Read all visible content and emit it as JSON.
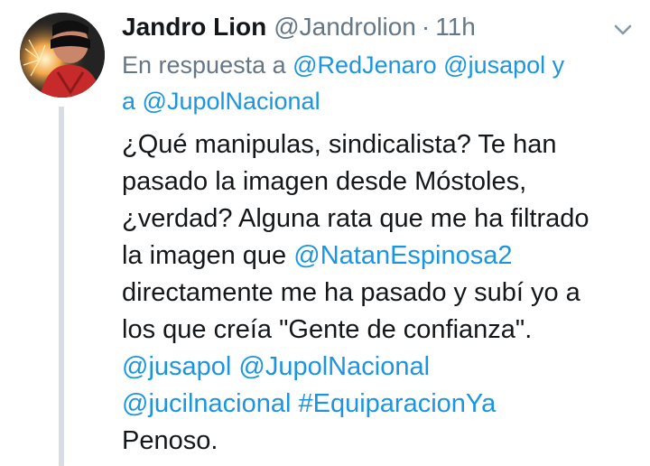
{
  "tweet": {
    "display_name": "Jandro Lion",
    "handle": "@Jandrolion",
    "separator": "·",
    "time": "11h",
    "reply_context": {
      "prefix": "En respuesta a",
      "mention_1": "@RedJenaro",
      "mention_2": "@jusapol",
      "conjunction": "y",
      "a_word": "a",
      "mention_3": "@JupolNacional"
    },
    "body": {
      "line_1": "¿Qué manipulas, sindicalista? Te han",
      "line_2": "pasado la imagen desde Móstoles,",
      "line_3": "¿verdad? Alguna rata que me ha filtrado",
      "line_4_prefix": "la imagen que",
      "mention_natan": "@NatanEspinosa2",
      "line_5": "directamente me ha pasado y subí yo a",
      "line_6": "los que creía \"Gente de confianza\".",
      "mention_jusapol": "@jusapol",
      "mention_jupol": "@JupolNacional",
      "mention_jucil": "@jucilnacional",
      "hashtag": "#EquiparacionYa",
      "closing": "Penoso."
    },
    "icons": {
      "caret": "chevron-down-icon",
      "avatar": "avatar-image"
    },
    "colors": {
      "link": "#1b95e0",
      "secondary_text": "#657786",
      "primary_text": "#14171a",
      "thread_line": "#d7dde2"
    }
  }
}
